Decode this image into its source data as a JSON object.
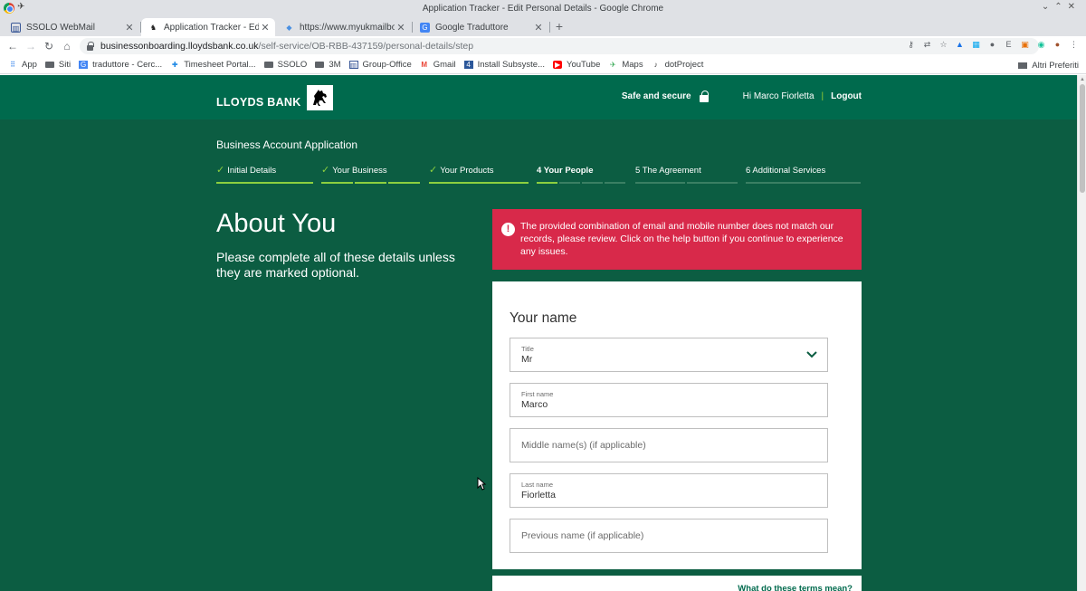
{
  "window": {
    "title": "Application Tracker - Edit Personal Details - Google Chrome"
  },
  "tabs": [
    {
      "label": "SSOLO WebMail",
      "active": false
    },
    {
      "label": "Application Tracker - Edit Per",
      "active": true
    },
    {
      "label": "https://www.myukmailbox.c",
      "active": false
    },
    {
      "label": "Google Traduttore",
      "active": false
    }
  ],
  "address_bar": {
    "url_host": "businessonboarding.lloydsbank.co.uk",
    "url_path": "/self-service/OB-RBB-437159/personal-details/step"
  },
  "bookmarks": [
    {
      "label": "App",
      "icon": "apps-grid-icon"
    },
    {
      "label": "Siti",
      "icon": "folder-icon"
    },
    {
      "label": "traduttore - Cerc...",
      "icon": "translate-icon"
    },
    {
      "label": "Timesheet Portal...",
      "icon": "timesheet-icon"
    },
    {
      "label": "SSOLO",
      "icon": "folder-icon"
    },
    {
      "label": "3M",
      "icon": "folder-icon"
    },
    {
      "label": "Group-Office",
      "icon": "group-office-icon"
    },
    {
      "label": "Gmail",
      "icon": "gmail-icon"
    },
    {
      "label": "Install Subsyste...",
      "icon": "install-icon"
    },
    {
      "label": "YouTube",
      "icon": "youtube-icon"
    },
    {
      "label": "Maps",
      "icon": "maps-icon"
    },
    {
      "label": "dotProject",
      "icon": "dotproject-icon"
    }
  ],
  "bookmarks_other": "Altri Preferiti",
  "site": {
    "brand": "LLOYDS BANK",
    "safe_label": "Safe and secure",
    "greeting": "Hi Marco Fiorletta",
    "divider": "|",
    "logout": "Logout"
  },
  "application": {
    "title": "Business Account Application",
    "steps": [
      {
        "label": "Initial Details",
        "status": "complete"
      },
      {
        "label": "Your Business",
        "status": "complete"
      },
      {
        "label": "Your Products",
        "status": "complete"
      },
      {
        "label": "4  Your People",
        "status": "current"
      },
      {
        "label": "5  The Agreement",
        "status": "upcoming"
      },
      {
        "label": "6  Additional Services",
        "status": "upcoming"
      }
    ]
  },
  "about": {
    "heading": "About You",
    "subtitle": "Please complete all of these details unless they are marked optional."
  },
  "error": {
    "icon": "!",
    "message": "The provided combination of email and mobile number does not match our records, please review. Click on the help button if you continue to experience any issues."
  },
  "name_form": {
    "title": "Your name",
    "title_field": {
      "label": "Title",
      "value": "Mr"
    },
    "first_name": {
      "label": "First name",
      "value": "Marco"
    },
    "middle_name": {
      "placeholder": "Middle name(s) (if applicable)"
    },
    "last_name": {
      "label": "Last name",
      "value": "Fiorletta"
    },
    "previous_name": {
      "placeholder": "Previous name (if applicable)"
    }
  },
  "terms_link": "What do these terms mean?",
  "colors": {
    "page_bg": "#0c5d42",
    "header_bg": "#006a4d",
    "accent_green": "#8ccf3f",
    "error_red": "#d8294a"
  }
}
